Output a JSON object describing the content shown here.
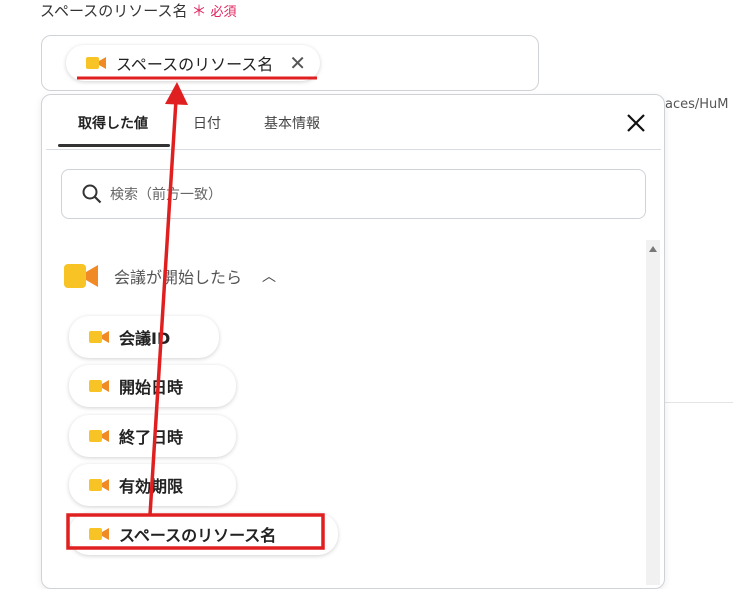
{
  "field": {
    "label": "スペースのリソース名",
    "required_star": "＊",
    "required_text": "必須",
    "selected_chip": "スペースのリソース名",
    "selected_chip_remove": "✕"
  },
  "side_text": "aces/HuM",
  "panel": {
    "tabs": [
      {
        "label": "取得した値",
        "active": true
      },
      {
        "label": "日付",
        "active": false
      },
      {
        "label": "基本情報",
        "active": false
      }
    ],
    "search_placeholder": "検索（前方一致）",
    "group": {
      "label": "会議が開始したら",
      "caret": "︿",
      "options": [
        {
          "label": "会議ID"
        },
        {
          "label": "開始日時"
        },
        {
          "label": "終了日時"
        },
        {
          "label": "有効期限"
        },
        {
          "label": "スペースのリソース名"
        }
      ]
    }
  },
  "colors": {
    "annotation": "#e02020",
    "required": "#e0245e",
    "icon": "#f7c325"
  },
  "icons": [
    "video-camera-icon",
    "close-icon",
    "search-icon",
    "chevron-up-icon",
    "scroll-up-arrow"
  ]
}
